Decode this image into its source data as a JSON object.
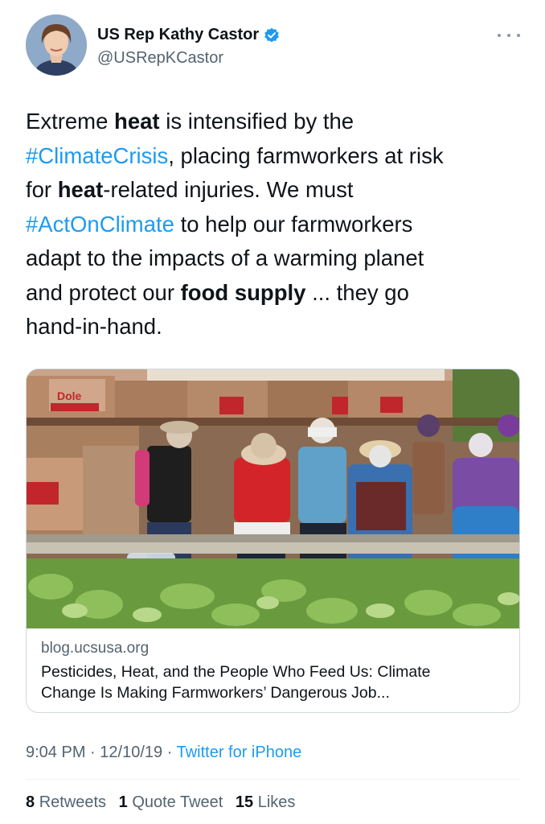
{
  "author": {
    "display_name": "US Rep Kathy Castor",
    "handle": "@USRepKCastor",
    "avatar_icon": "profile-photo",
    "verified_icon": "verified-badge-icon"
  },
  "tweet": {
    "lines": [
      [
        {
          "t": "Extreme "
        },
        {
          "t": "heat",
          "s": "b"
        },
        {
          "t": " is intensified by the"
        }
      ],
      [
        {
          "t": "#ClimateCrisis",
          "s": "hl"
        },
        {
          "t": ", placing farmworkers at risk"
        }
      ],
      [
        {
          "t": "for "
        },
        {
          "t": "heat",
          "s": "b"
        },
        {
          "t": "-related injuries. We must"
        }
      ],
      [
        {
          "t": "#ActOnClimate",
          "s": "hl"
        },
        {
          "t": " to help our farmworkers"
        }
      ],
      [
        {
          "t": "adapt to the impacts of a warming planet"
        }
      ],
      [
        {
          "t": "and protect our "
        },
        {
          "t": "food supply",
          "s": "b"
        },
        {
          "t": " ... they go"
        }
      ],
      [
        {
          "t": "hand-in-hand."
        }
      ]
    ]
  },
  "card": {
    "domain": "blog.ucsusa.org",
    "title_line1": "Pesticides, Heat, and the People Who Feed Us: Climate",
    "title_line2": "Change Is Making Farmworkers’ Dangerous Job...",
    "image_icon": "farmworkers-lettuce-field-photo",
    "box_label": "Dole"
  },
  "meta": {
    "time": "9:04 PM",
    "sep": "·",
    "date": "12/10/19",
    "source": "Twitter for iPhone"
  },
  "stats": {
    "retweets_count": "8",
    "retweets_label": "Retweets",
    "quotes_count": "1",
    "quotes_label": "Quote Tweet",
    "likes_count": "15",
    "likes_label": "Likes"
  },
  "colors": {
    "link_blue": "#1d9bf0",
    "secondary_text": "#536471",
    "primary_text": "#0f1419"
  }
}
